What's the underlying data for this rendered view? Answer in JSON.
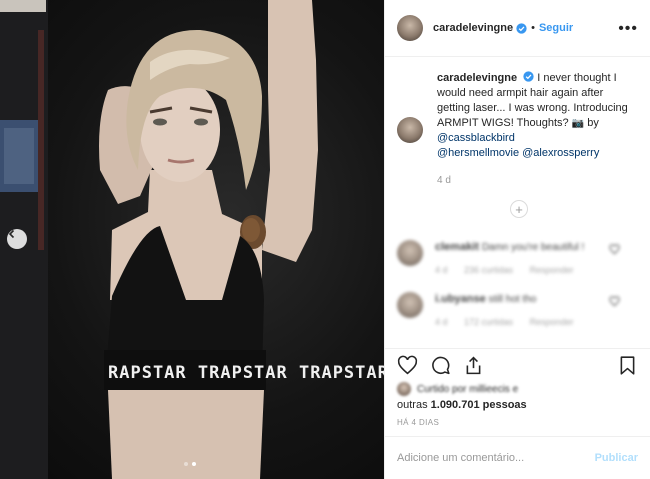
{
  "post": {
    "author": {
      "username": "caradelevingne",
      "verified": true,
      "follow_label": "Seguir",
      "separator": "•"
    },
    "more_label": "•••",
    "photo": {
      "subject": "woman with short blonde hair in a black sports bra, arm raised showing armpit hair",
      "bra_band_text": "RAPSTAR TRAPSTAR TRAPSTAR",
      "carousel": {
        "current": 2,
        "total": 2
      }
    },
    "caption": {
      "username": "caradelevingne",
      "text": " I never thought I would need armpit hair again after getting laser... I was wrong. Introducing ARMPIT WIGS! Thoughts? ",
      "camera_glyph": "📷",
      "by_text": " by ",
      "mentions": [
        "@cassblackbird",
        "@hersmellmovie",
        "@alexrossperry"
      ],
      "age": "4 d"
    },
    "load_more_glyph": "+",
    "replies": [
      {
        "username": "clemakit",
        "text": "Damn you're beautiful !",
        "meta": [
          "4 d",
          "236 curtidas",
          "Responder"
        ]
      },
      {
        "username": "i.ubyanse",
        "text": "still hot tho",
        "meta": [
          "4 d",
          "172 curtidas",
          "Responder"
        ]
      }
    ],
    "liked_by_text": "Curtido por millieecis e",
    "likes_prefix": "outras ",
    "likes_count": "1.090.701",
    "likes_suffix": " pessoas",
    "timestamp": "HÁ 4 DIAS",
    "comment_placeholder": "Adicione um comentário...",
    "publish_label": "Publicar"
  },
  "icons": [
    "chevron-left-icon",
    "verified-badge-icon",
    "more-options-icon",
    "heart-icon",
    "comment-icon",
    "share-icon",
    "bookmark-icon",
    "add-circle-icon"
  ],
  "colors": {
    "accent": "#3897f0",
    "mention": "#003569",
    "muted": "#999999",
    "border": "#efefef",
    "publish_disabled": "#b2dffc"
  }
}
